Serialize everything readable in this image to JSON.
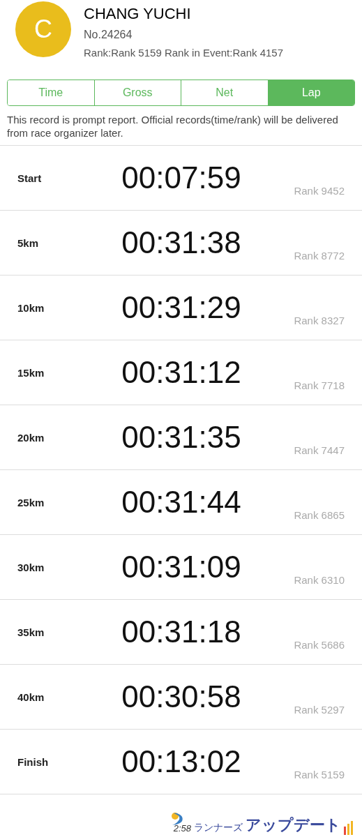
{
  "runner": {
    "initial": "C",
    "name": "CHANG YUCHI",
    "number": "No.24264",
    "rank": "Rank:Rank 5159 Rank in Event:Rank 4157"
  },
  "tabs": [
    {
      "label": "Time",
      "selected": false
    },
    {
      "label": "Gross",
      "selected": false
    },
    {
      "label": "Net",
      "selected": false
    },
    {
      "label": "Lap",
      "selected": true
    }
  ],
  "notice": "This record is prompt report. Official records(time/rank) will be delivered from race organizer later.",
  "splits": [
    {
      "point": "Start",
      "time": "00:07:59",
      "rank": "Rank 9452"
    },
    {
      "point": "5km",
      "time": "00:31:38",
      "rank": "Rank 8772"
    },
    {
      "point": "10km",
      "time": "00:31:29",
      "rank": "Rank 8327"
    },
    {
      "point": "15km",
      "time": "00:31:12",
      "rank": "Rank 7718"
    },
    {
      "point": "20km",
      "time": "00:31:35",
      "rank": "Rank 7447"
    },
    {
      "point": "25km",
      "time": "00:31:44",
      "rank": "Rank 6865"
    },
    {
      "point": "30km",
      "time": "00:31:09",
      "rank": "Rank 6310"
    },
    {
      "point": "35km",
      "time": "00:31:18",
      "rank": "Rank 5686"
    },
    {
      "point": "40km",
      "time": "00:30:58",
      "rank": "Rank 5297"
    },
    {
      "point": "Finish",
      "time": "00:13:02",
      "rank": "Rank 5159"
    }
  ],
  "footer": {
    "clock": "2:58",
    "brand_left": "ランナーズ",
    "brand_right": "アップデート"
  }
}
